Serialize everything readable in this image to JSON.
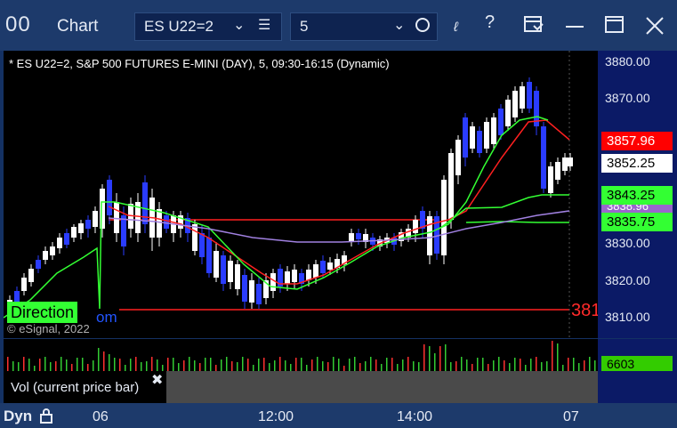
{
  "window": {
    "app_icon": "00",
    "title": "Chart",
    "symbol": "ES U22=2",
    "interval": "5",
    "icons": [
      "chevron-down-icon",
      "list-icon",
      "clock-icon",
      "draw-icon",
      "help-icon",
      "layout-icon",
      "maximize-icon",
      "close-icon"
    ]
  },
  "chart": {
    "title": "* ES U22=2, S&P 500 FUTURES E-MINI (DAY), 5, 09:30-16:15 (Dynamic)",
    "direction_label": "Direction",
    "direction_link": "om",
    "copyright": "© eSignal, 2022",
    "right_edge_text": "381",
    "price_levels": [
      "3880.00",
      "3870.00",
      "3830.00",
      "3820.00",
      "3810.00"
    ],
    "price_tags": [
      {
        "value": "3857.96",
        "bg": "#ff0000",
        "fg": "#ffffff"
      },
      {
        "value": "3852.25",
        "bg": "#ffffff",
        "fg": "#000000"
      },
      {
        "value": "3843.25",
        "bg": "#33ff33",
        "fg": "#000000"
      },
      {
        "value": "3838.96",
        "bg": "#9966cc",
        "fg": "#ffffff"
      },
      {
        "value": "3835.75",
        "bg": "#33ff33",
        "fg": "#000000"
      }
    ],
    "colors": {
      "up": "#ffffff",
      "down": "#2a3cff",
      "ma_red": "#ff2020",
      "ma_green": "#33ff33",
      "ma_purple": "#a080e0"
    }
  },
  "volume": {
    "value": "6603",
    "legend": "Vol (current price bar)"
  },
  "timebar": {
    "mode": "Dyn",
    "labels": [
      "06",
      "12:00",
      "14:00",
      "07"
    ]
  }
}
